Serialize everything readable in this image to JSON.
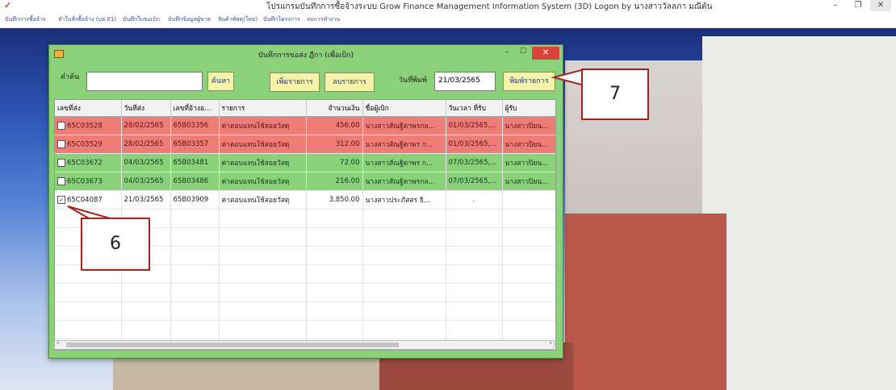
{
  "app": {
    "title": "โปรแกรมบันทึกการซื้อจ้างระบบ  Grow Finance Management Information System (3D) Logon by นางสาววัลลภา มณีต้น",
    "logo": "✓"
  },
  "window_controls": {
    "minimize": "–",
    "maximize": "❐",
    "close": "✕"
  },
  "menu": [
    "บันทึกการซื้อจ้าง",
    "ทำใบสั่งซื้อจ้าง (บส.01)",
    "บันทึกใบขอเบิก",
    "บันทึกข้อมูลผู้ขาย",
    "สินค้าพัสดุ(ใหม่)",
    "บันทึกโครงการ",
    "จบการทำงาน"
  ],
  "dialog": {
    "title": "บันทึกการขอส่ง ฎีกา (เพื่อเบิก)",
    "minimize": "–",
    "maximize": "☐",
    "close": "✕",
    "search_label": "คำค้น",
    "search_value": "",
    "search_button": "ค้นหา",
    "add_button": "เพิ่มรายการ",
    "delete_button": "ลบรายการ",
    "print_date_label": "วันที่พิมพ์",
    "print_date_value": "21/03/2565",
    "print_button": "พิมพ์รายการ"
  },
  "table": {
    "columns": [
      "เลขที่ส่ง",
      "วันที่ส่ง",
      "เลขที่อ้างอ...",
      "รายการ",
      "จำนวนเงิน",
      "ชื่อผู้เบิก",
      "วันเวลา ที่รับ",
      "ผู้รับ"
    ],
    "rows": [
      {
        "checked": false,
        "status": "red",
        "cells": [
          "65C03528",
          "28/02/2565",
          "65B03356",
          "ค่าตอบแทนใช้สอยวัสดุ",
          "456.00",
          "นางสาวสัณฐิตาพรกล...",
          "01/03/2565,...",
          "นางสาวปิยน..."
        ]
      },
      {
        "checked": false,
        "status": "red",
        "cells": [
          "65C03529",
          "28/02/2565",
          "65B03357",
          "ค่าตอบแทนใช้สอยวัสดุ",
          "312.00",
          "นางสาวสัณฐิตาพร ก...",
          "01/03/2565,...",
          "นางสาวปิยน..."
        ]
      },
      {
        "checked": false,
        "status": "green",
        "cells": [
          "65C03672",
          "04/03/2565",
          "65B03481",
          "ค่าตอบแทนใช้สอยวัสดุ",
          "72.00",
          "นางสาวสัณฐิตาพร ก...",
          "07/03/2565,...",
          "นางสาวปิยน..."
        ]
      },
      {
        "checked": false,
        "status": "green",
        "cells": [
          "65C03673",
          "04/03/2565",
          "65B03486",
          "ค่าตอบแทนใช้สอยวัสดุ",
          "216.00",
          "นางสาวสัณฐิตาพรกล...",
          "07/03/2565,...",
          "นางสาวปิยน..."
        ]
      },
      {
        "checked": true,
        "status": "white",
        "cells": [
          "65C04087",
          "21/03/2565",
          "65B03909",
          "ค่าตอบแทนใช้สอยวัสดุ",
          "3,850.00",
          "นางสาวประภัสสร ธิ...",
          ".",
          ""
        ]
      }
    ]
  },
  "scrollbar": {
    "left": "‹",
    "right": "›"
  },
  "callouts": {
    "row_check": "6",
    "print": "7"
  },
  "colors": {
    "dialog_bg": "#8ad17a",
    "row_red": "#ee7d78",
    "row_green": "#8ad17a",
    "button_yellow": "#f6f3a8",
    "callout_border": "#a3241d"
  }
}
